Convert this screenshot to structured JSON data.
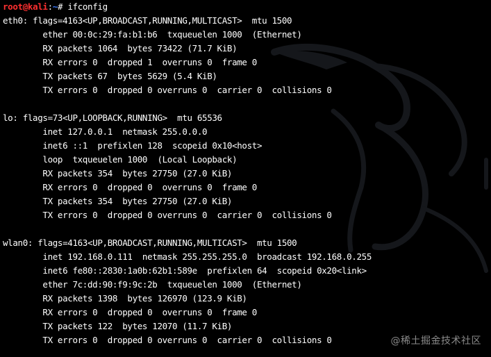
{
  "prompt": {
    "user": "root",
    "at": "@",
    "host": "kali",
    "sep": ":",
    "path": "~",
    "symbol": "#",
    "command": "ifconfig"
  },
  "output_lines": [
    "eth0: flags=4163<UP,BROADCAST,RUNNING,MULTICAST>  mtu 1500",
    "        ether 00:0c:29:fa:b1:b6  txqueuelen 1000  (Ethernet)",
    "        RX packets 1064  bytes 73422 (71.7 KiB)",
    "        RX errors 0  dropped 1  overruns 0  frame 0",
    "        TX packets 67  bytes 5629 (5.4 KiB)",
    "        TX errors 0  dropped 0 overruns 0  carrier 0  collisions 0",
    "",
    "lo: flags=73<UP,LOOPBACK,RUNNING>  mtu 65536",
    "        inet 127.0.0.1  netmask 255.0.0.0",
    "        inet6 ::1  prefixlen 128  scopeid 0x10<host>",
    "        loop  txqueuelen 1000  (Local Loopback)",
    "        RX packets 354  bytes 27750 (27.0 KiB)",
    "        RX errors 0  dropped 0  overruns 0  frame 0",
    "        TX packets 354  bytes 27750 (27.0 KiB)",
    "        TX errors 0  dropped 0 overruns 0  carrier 0  collisions 0",
    "",
    "wlan0: flags=4163<UP,BROADCAST,RUNNING,MULTICAST>  mtu 1500",
    "        inet 192.168.0.111  netmask 255.255.255.0  broadcast 192.168.0.255",
    "        inet6 fe80::2830:1a0b:62b1:589e  prefixlen 64  scopeid 0x20<link>",
    "        ether 7c:dd:90:f9:9c:2b  txqueuelen 1000  (Ethernet)",
    "        RX packets 1398  bytes 126970 (123.9 KiB)",
    "        RX errors 0  dropped 0  overruns 0  frame 0",
    "        TX packets 122  bytes 12070 (11.7 KiB)",
    "        TX errors 0  dropped 0 overruns 0  carrier 0  collisions 0"
  ],
  "watermark": "@稀土掘金技术社区",
  "colors": {
    "background": "#000000",
    "text": "#ffffff",
    "prompt_user": "#ff3030",
    "prompt_path": "#3a7bff",
    "dragon": "#16181c",
    "watermark": "#8a8a8a"
  },
  "icons": {
    "background_logo": "kali-dragon-icon"
  }
}
